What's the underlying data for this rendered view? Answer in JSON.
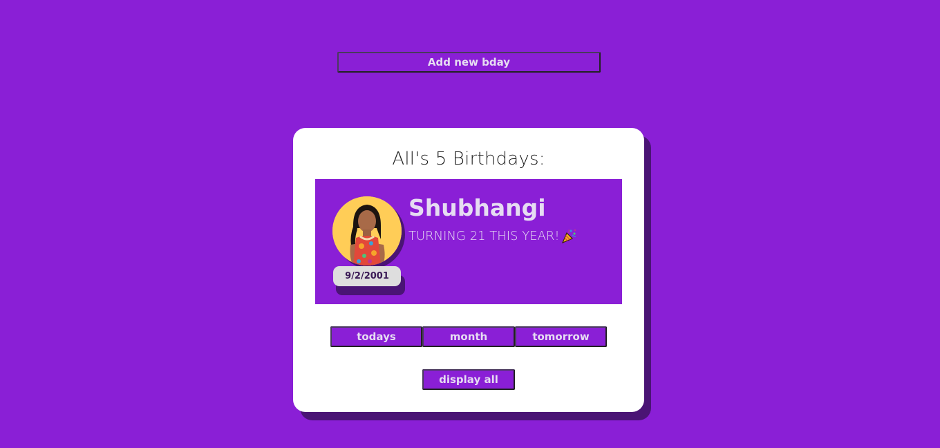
{
  "header": {
    "add_button_label": "Add new bday"
  },
  "card": {
    "title": "All's 5 Birthdays:",
    "birthday": {
      "name": "Shubhangi",
      "turning_text": "TURNING 21 THIS YEAR!",
      "date": "9/2/2001",
      "avatar_icon": "person-photo",
      "party_icon": "party-popper-icon"
    },
    "filters": {
      "todays_label": "todays",
      "month_label": "month",
      "tomorrow_label": "tomorrow"
    },
    "display_all_label": "display all"
  },
  "colors": {
    "background": "#8a1fd6",
    "card": "#ffffff",
    "shadow": "#4a1475",
    "text_light": "#e6dcf2",
    "avatar_bg": "#ffcd57"
  }
}
